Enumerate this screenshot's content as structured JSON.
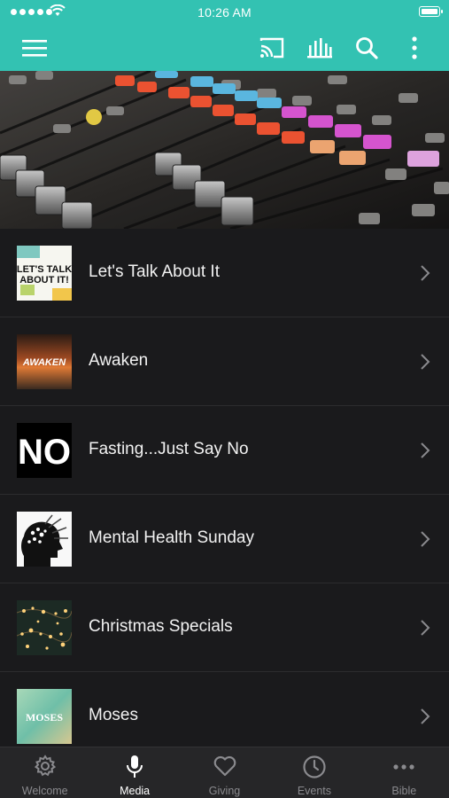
{
  "status_bar": {
    "time": "10:26 AM"
  },
  "header": {
    "menu_icon": "hamburger-menu-icon",
    "cast_icon": "cast-icon",
    "equalizer_icon": "audio-bars-icon",
    "search_icon": "search-icon",
    "more_icon": "more-vertical-icon",
    "accent_color": "#33c2b2"
  },
  "hero": {
    "image": "audio-mixing-console-photo"
  },
  "media_list": {
    "items": [
      {
        "title": "Let's Talk About It",
        "thumb_text": "LET'S TALK ABOUT IT!"
      },
      {
        "title": "Awaken",
        "thumb_text": "AWAKEN"
      },
      {
        "title": "Fasting...Just Say No",
        "thumb_text": "NO"
      },
      {
        "title": "Mental Health Sunday",
        "thumb_text": ""
      },
      {
        "title": "Christmas Specials",
        "thumb_text": ""
      },
      {
        "title": "Moses",
        "thumb_text": "MOSES"
      }
    ]
  },
  "tabbar": {
    "tabs": [
      {
        "label": "Welcome",
        "icon": "gear-icon",
        "active": false
      },
      {
        "label": "Media",
        "icon": "microphone-icon",
        "active": true
      },
      {
        "label": "Giving",
        "icon": "heart-icon",
        "active": false
      },
      {
        "label": "Events",
        "icon": "clock-icon",
        "active": false
      },
      {
        "label": "Bible",
        "icon": "more-horizontal-icon",
        "active": false
      }
    ]
  }
}
